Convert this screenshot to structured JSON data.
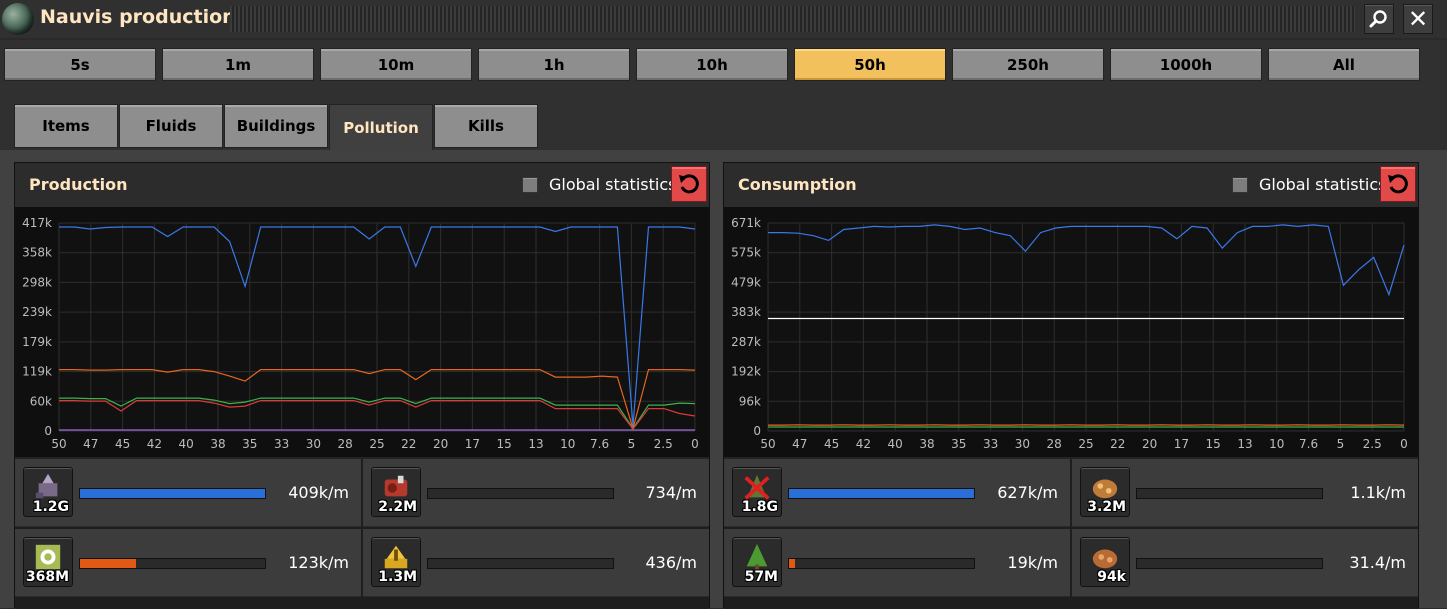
{
  "window": {
    "title": "Nauvis production"
  },
  "time_buttons": [
    "5s",
    "1m",
    "10m",
    "1h",
    "10h",
    "50h",
    "250h",
    "1000h",
    "All"
  ],
  "active_time": "50h",
  "tabs": [
    "Items",
    "Fluids",
    "Buildings",
    "Pollution",
    "Kills"
  ],
  "active_tab": "Pollution",
  "production": {
    "title": "Production",
    "global_label": "Global statistics",
    "rows": [
      {
        "count": "1.2G",
        "value": "409k/m",
        "fill": 1.0,
        "color": "#2a6ed8",
        "icon": "mining-drill-icon"
      },
      {
        "count": "2.2M",
        "value": "734/m",
        "fill": 0.0,
        "color": "#2a6ed8",
        "icon": "steam-engine-icon"
      },
      {
        "count": "368M",
        "value": "123k/m",
        "fill": 0.3,
        "color": "#e05a16",
        "icon": "assembler-icon"
      },
      {
        "count": "1.3M",
        "value": "436/m",
        "fill": 0.0,
        "color": "#e05a16",
        "icon": "pumpjack-icon"
      }
    ]
  },
  "consumption": {
    "title": "Consumption",
    "global_label": "Global statistics",
    "rows": [
      {
        "count": "1.8G",
        "value": "627k/m",
        "fill": 1.0,
        "color": "#2a6ed8",
        "icon": "dead-tree-icon"
      },
      {
        "count": "3.2M",
        "value": "1.1k/m",
        "fill": 0.0,
        "color": "#2a6ed8",
        "icon": "spawner-icon"
      },
      {
        "count": "57M",
        "value": "19k/m",
        "fill": 0.03,
        "color": "#e05a16",
        "icon": "tree-icon"
      },
      {
        "count": "94k",
        "value": "31.4/m",
        "fill": 0.0,
        "color": "#e05a16",
        "icon": "biter-spawner-icon"
      }
    ]
  },
  "colors": {
    "accent_active": "#f2c15d",
    "title_text": "#ffe6c0",
    "reset": "#e24a4a"
  },
  "chart_data": [
    {
      "type": "line",
      "title": "Production",
      "x_ticks": [
        "50",
        "47",
        "45",
        "42",
        "40",
        "38",
        "35",
        "33",
        "30",
        "28",
        "25",
        "22",
        "20",
        "17",
        "15",
        "13",
        "10",
        "7.6",
        "5",
        "2.5",
        "0"
      ],
      "y_ticks": [
        "0",
        "60k",
        "119k",
        "179k",
        "239k",
        "298k",
        "358k",
        "417k"
      ],
      "ylim": [
        0,
        417000
      ],
      "x_range": [
        50,
        0
      ],
      "grid": true,
      "series": [
        {
          "color": "#3a78e8",
          "values": [
            409000,
            409000,
            405000,
            408000,
            409000,
            409000,
            409000,
            390000,
            409000,
            409000,
            409000,
            380000,
            290000,
            409000,
            409000,
            409000,
            409000,
            409000,
            409000,
            409000,
            385000,
            409000,
            409000,
            330000,
            409000,
            409000,
            409000,
            409000,
            409000,
            409000,
            409000,
            409000,
            400000,
            409000,
            409000,
            409000,
            409000,
            10000,
            409000,
            409000,
            409000,
            405000
          ]
        },
        {
          "color": "#e5661e",
          "values": [
            123000,
            123000,
            122000,
            122000,
            123000,
            123000,
            123000,
            118000,
            123000,
            123000,
            119000,
            110000,
            100000,
            123000,
            123000,
            123000,
            123000,
            123000,
            123000,
            123000,
            115000,
            123000,
            123000,
            103000,
            123000,
            123000,
            123000,
            123000,
            123000,
            123000,
            123000,
            123000,
            108000,
            108000,
            108000,
            110000,
            108000,
            5000,
            123000,
            123000,
            123000,
            122000
          ]
        },
        {
          "color": "#3fb14a",
          "values": [
            66000,
            66000,
            65000,
            65000,
            50000,
            66000,
            66000,
            66000,
            66000,
            66000,
            62000,
            55000,
            58000,
            66000,
            66000,
            66000,
            66000,
            66000,
            66000,
            66000,
            58000,
            66000,
            66000,
            55000,
            66000,
            66000,
            66000,
            66000,
            66000,
            66000,
            66000,
            66000,
            52000,
            52000,
            52000,
            52000,
            52000,
            5000,
            52000,
            52000,
            56000,
            55000
          ]
        },
        {
          "color": "#d83a3a",
          "values": [
            61000,
            61000,
            60000,
            60000,
            40000,
            61000,
            61000,
            61000,
            61000,
            61000,
            56000,
            48000,
            50000,
            61000,
            61000,
            61000,
            61000,
            61000,
            61000,
            61000,
            52000,
            61000,
            61000,
            48000,
            61000,
            61000,
            61000,
            61000,
            61000,
            61000,
            61000,
            61000,
            45000,
            45000,
            45000,
            45000,
            45000,
            4000,
            45000,
            45000,
            35000,
            30000
          ]
        },
        {
          "color": "#9b6ad6",
          "values": [
            2000,
            2000,
            2000,
            2000,
            2000,
            2000,
            2000,
            2000,
            2000,
            2000,
            2000,
            2000,
            2000,
            2000,
            2000,
            2000,
            2000,
            2000,
            2000,
            2000,
            2000,
            2000,
            2000,
            2000,
            2000,
            2000,
            2000,
            2000,
            2000,
            2000,
            2000,
            2000,
            2000,
            2000,
            2000,
            2000,
            2000,
            2000,
            2000,
            2000,
            2000,
            2000
          ]
        }
      ]
    },
    {
      "type": "line",
      "title": "Consumption",
      "x_ticks": [
        "50",
        "47",
        "45",
        "42",
        "40",
        "38",
        "35",
        "33",
        "30",
        "28",
        "25",
        "22",
        "20",
        "17",
        "15",
        "13",
        "10",
        "7.6",
        "5",
        "2.5",
        "0"
      ],
      "y_ticks": [
        "0",
        "96k",
        "192k",
        "287k",
        "383k",
        "479k",
        "575k",
        "671k"
      ],
      "ylim": [
        0,
        671000
      ],
      "x_range": [
        50,
        0
      ],
      "grid": true,
      "series": [
        {
          "color": "#3a78e8",
          "values": [
            640000,
            640000,
            638000,
            630000,
            615000,
            650000,
            655000,
            660000,
            658000,
            660000,
            660000,
            665000,
            660000,
            650000,
            655000,
            640000,
            630000,
            580000,
            640000,
            655000,
            660000,
            660000,
            660000,
            660000,
            660000,
            660000,
            655000,
            620000,
            660000,
            655000,
            590000,
            640000,
            660000,
            660000,
            665000,
            660000,
            665000,
            660000,
            470000,
            520000,
            560000,
            440000,
            600000
          ]
        },
        {
          "color": "#ffffff",
          "values": [
            363000,
            363000,
            363000,
            363000,
            363000,
            363000,
            363000,
            363000,
            363000,
            363000,
            363000,
            363000,
            363000,
            363000,
            363000,
            363000,
            363000,
            363000,
            363000,
            363000,
            363000,
            363000,
            363000,
            363000,
            363000,
            363000,
            363000,
            363000,
            363000,
            363000,
            363000,
            363000,
            363000,
            363000,
            363000,
            363000,
            363000,
            363000,
            363000,
            363000,
            363000,
            363000,
            363000
          ]
        },
        {
          "color": "#e5661e",
          "values": [
            19000,
            19000,
            20000,
            19000,
            19000,
            20000,
            19000,
            19000,
            20000,
            19000,
            19000,
            20000,
            19000,
            19000,
            20000,
            19000,
            19000,
            20000,
            19000,
            19000,
            20000,
            19000,
            19000,
            20000,
            19000,
            19000,
            20000,
            19000,
            19000,
            20000,
            19000,
            19000,
            20000,
            19000,
            19000,
            20000,
            19000,
            19000,
            20000,
            19000,
            19000,
            20000,
            19000
          ]
        },
        {
          "color": "#3fb14a",
          "values": [
            13000,
            13000,
            13000,
            13000,
            13000,
            13000,
            13000,
            13000,
            13000,
            13000,
            13000,
            13000,
            13000,
            13000,
            13000,
            13000,
            13000,
            13000,
            13000,
            13000,
            13000,
            13000,
            13000,
            13000,
            13000,
            13000,
            13000,
            13000,
            13000,
            13000,
            13000,
            13000,
            13000,
            13000,
            13000,
            13000,
            13000,
            13000,
            13000,
            13000,
            13000,
            13000,
            13000
          ]
        }
      ]
    }
  ]
}
